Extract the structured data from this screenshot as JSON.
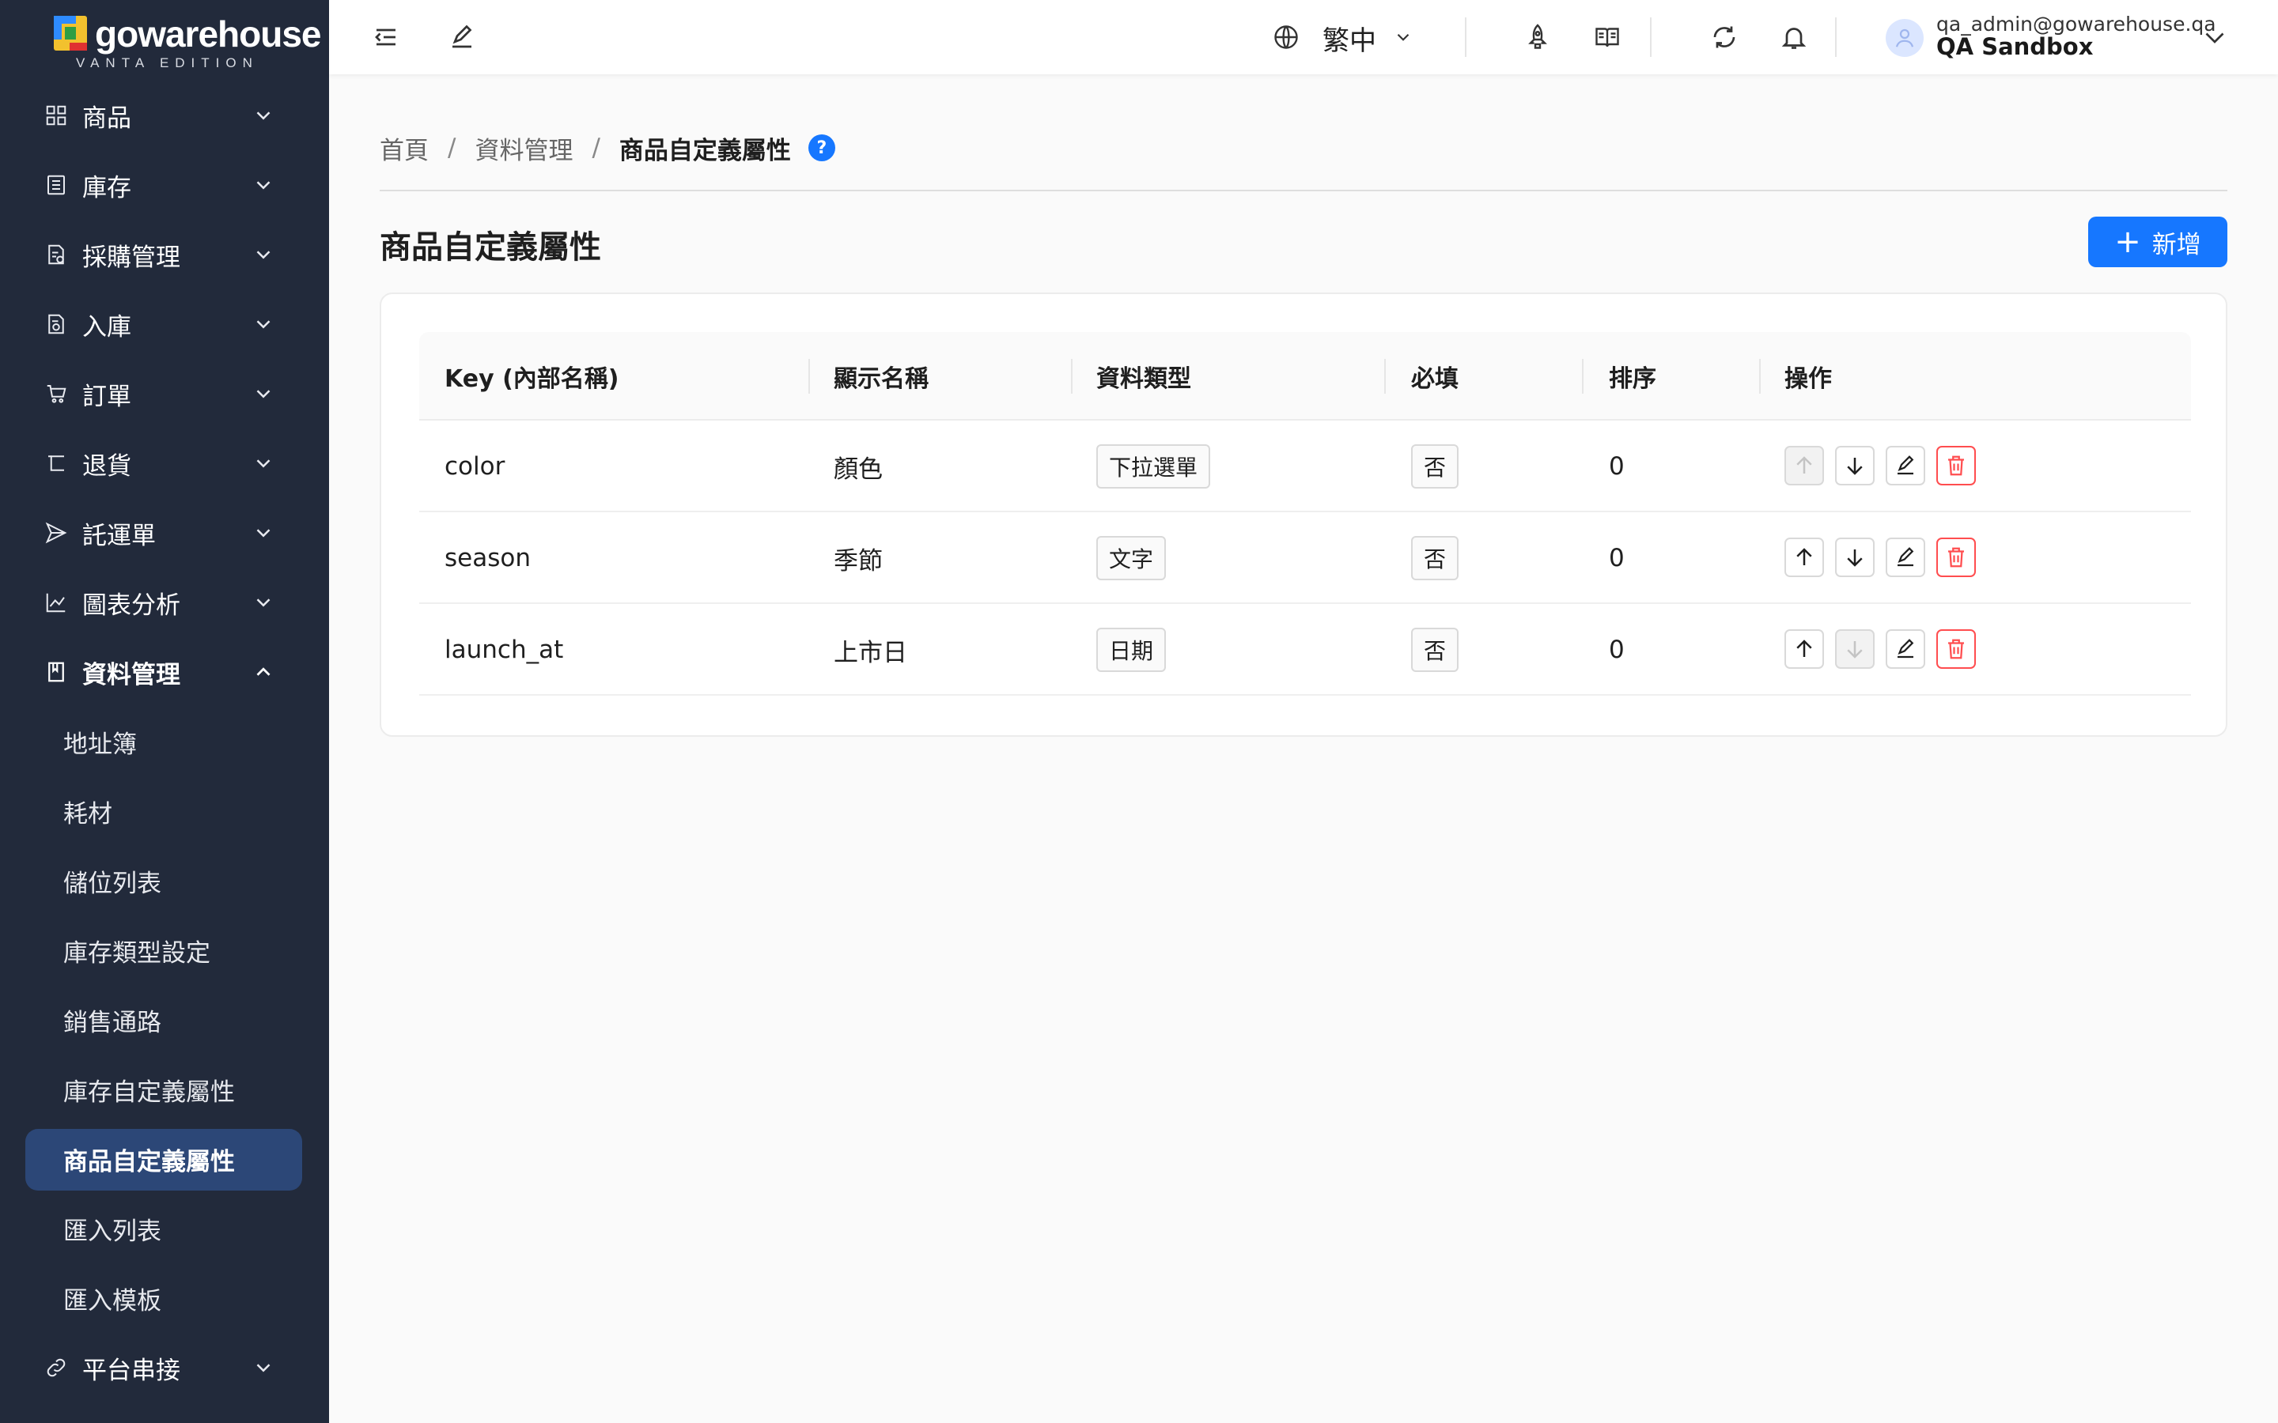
{
  "brand": {
    "name": "gowarehouse",
    "edition": "VANTA EDITION"
  },
  "sidebar": {
    "items": [
      {
        "label": "商品",
        "icon": "grid-icon"
      },
      {
        "label": "庫存",
        "icon": "inventory-icon"
      },
      {
        "label": "採購管理",
        "icon": "purchase-icon"
      },
      {
        "label": "入庫",
        "icon": "inbound-icon"
      },
      {
        "label": "訂單",
        "icon": "cart-icon"
      },
      {
        "label": "退貨",
        "icon": "return-icon"
      },
      {
        "label": "託運單",
        "icon": "send-icon"
      },
      {
        "label": "圖表分析",
        "icon": "chart-icon"
      },
      {
        "label": "資料管理",
        "icon": "book-icon"
      },
      {
        "label": "平台串接",
        "icon": "link-icon"
      }
    ],
    "data_mgmt_sub": [
      {
        "label": "地址簿"
      },
      {
        "label": "耗材"
      },
      {
        "label": "儲位列表"
      },
      {
        "label": "庫存類型設定"
      },
      {
        "label": "銷售通路"
      },
      {
        "label": "庫存自定義屬性"
      },
      {
        "label": "商品自定義屬性"
      },
      {
        "label": "匯入列表"
      },
      {
        "label": "匯入模板"
      }
    ],
    "active_sub": "商品自定義屬性"
  },
  "header": {
    "language": "繁中",
    "user_email": "qa_admin@gowarehouse.qa",
    "user_org": "QA Sandbox"
  },
  "breadcrumb": {
    "home": "首頁",
    "section": "資料管理",
    "current": "商品自定義屬性",
    "help": "?"
  },
  "page": {
    "title": "商品自定義屬性",
    "add_label": "新增"
  },
  "table": {
    "columns": [
      "Key (內部名稱)",
      "顯示名稱",
      "資料類型",
      "必填",
      "排序",
      "操作"
    ],
    "rows": [
      {
        "key": "color",
        "display": "顏色",
        "type": "下拉選單",
        "required": "否",
        "order": "0",
        "up_disabled": true,
        "down_disabled": false
      },
      {
        "key": "season",
        "display": "季節",
        "type": "文字",
        "required": "否",
        "order": "0",
        "up_disabled": false,
        "down_disabled": false
      },
      {
        "key": "launch_at",
        "display": "上市日",
        "type": "日期",
        "required": "否",
        "order": "0",
        "up_disabled": false,
        "down_disabled": true
      }
    ]
  },
  "colors": {
    "sidebar_bg": "#222a3b",
    "active_bg": "#2c4777",
    "primary": "#1677ff",
    "danger": "#ff4d4f"
  }
}
